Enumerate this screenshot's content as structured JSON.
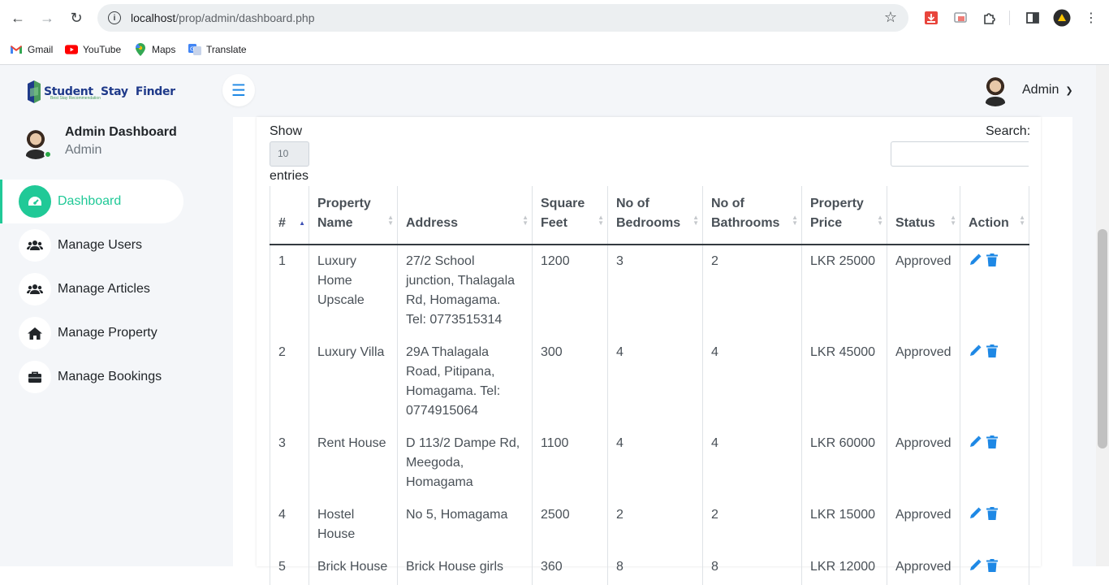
{
  "browser": {
    "url_host": "localhost",
    "url_path": "/prop/admin/dashboard.php",
    "bookmarks": [
      {
        "label": "Gmail"
      },
      {
        "label": "YouTube"
      },
      {
        "label": "Maps"
      },
      {
        "label": "Translate"
      }
    ]
  },
  "header": {
    "logo_text": "Student  Stay  Finder",
    "logo_sub": "Best Stay Recommendation",
    "user_name": "Admin"
  },
  "sidebar": {
    "profile_title": "Admin Dashboard",
    "profile_role": "Admin",
    "items": [
      {
        "label": "Dashboard",
        "icon": "tachometer-icon"
      },
      {
        "label": "Manage Users",
        "icon": "users-icon"
      },
      {
        "label": "Manage Articles",
        "icon": "users-icon"
      },
      {
        "label": "Manage Property",
        "icon": "home-icon"
      },
      {
        "label": "Manage Bookings",
        "icon": "briefcase-icon"
      }
    ]
  },
  "table_controls": {
    "show_label": "Show",
    "length_value": "10",
    "entries_label": "entries",
    "search_label": "Search:"
  },
  "table": {
    "headers": [
      "#",
      "Property Name",
      "Address",
      "Square Feet",
      "No of Bedrooms",
      "No of Bathrooms",
      "Property Price",
      "Status",
      "Action"
    ],
    "rows": [
      {
        "num": "1",
        "name": "Luxury Home Upscale",
        "address": "27/2 School junction, Thalagala Rd, Homagama. Tel: 0773515314",
        "sqft": "1200",
        "bedrooms": "3",
        "bathrooms": "2",
        "price": "LKR 25000",
        "status": "Approved"
      },
      {
        "num": "2",
        "name": "Luxury Villa",
        "address": "29A Thalagala Road, Pitipana, Homagama. Tel: 0774915064",
        "sqft": "300",
        "bedrooms": "4",
        "bathrooms": "4",
        "price": "LKR 45000",
        "status": "Approved"
      },
      {
        "num": "3",
        "name": "Rent House",
        "address": "D 113/2 Dampe Rd, Meegoda, Homagama",
        "sqft": "1100",
        "bedrooms": "4",
        "bathrooms": "4",
        "price": "LKR 60000",
        "status": "Approved"
      },
      {
        "num": "4",
        "name": "Hostel House",
        "address": "No 5, Homagama",
        "sqft": "2500",
        "bedrooms": "2",
        "bathrooms": "2",
        "price": "LKR 15000",
        "status": "Approved"
      },
      {
        "num": "5",
        "name": "Brick House",
        "address": "Brick House girls",
        "sqft": "360",
        "bedrooms": "8",
        "bathrooms": "8",
        "price": "LKR 12000",
        "status": "Approved"
      }
    ]
  },
  "colors": {
    "accent": "#20c997",
    "action_icon": "#1e88e5",
    "sidebar_bg": "#f4f6f9"
  }
}
